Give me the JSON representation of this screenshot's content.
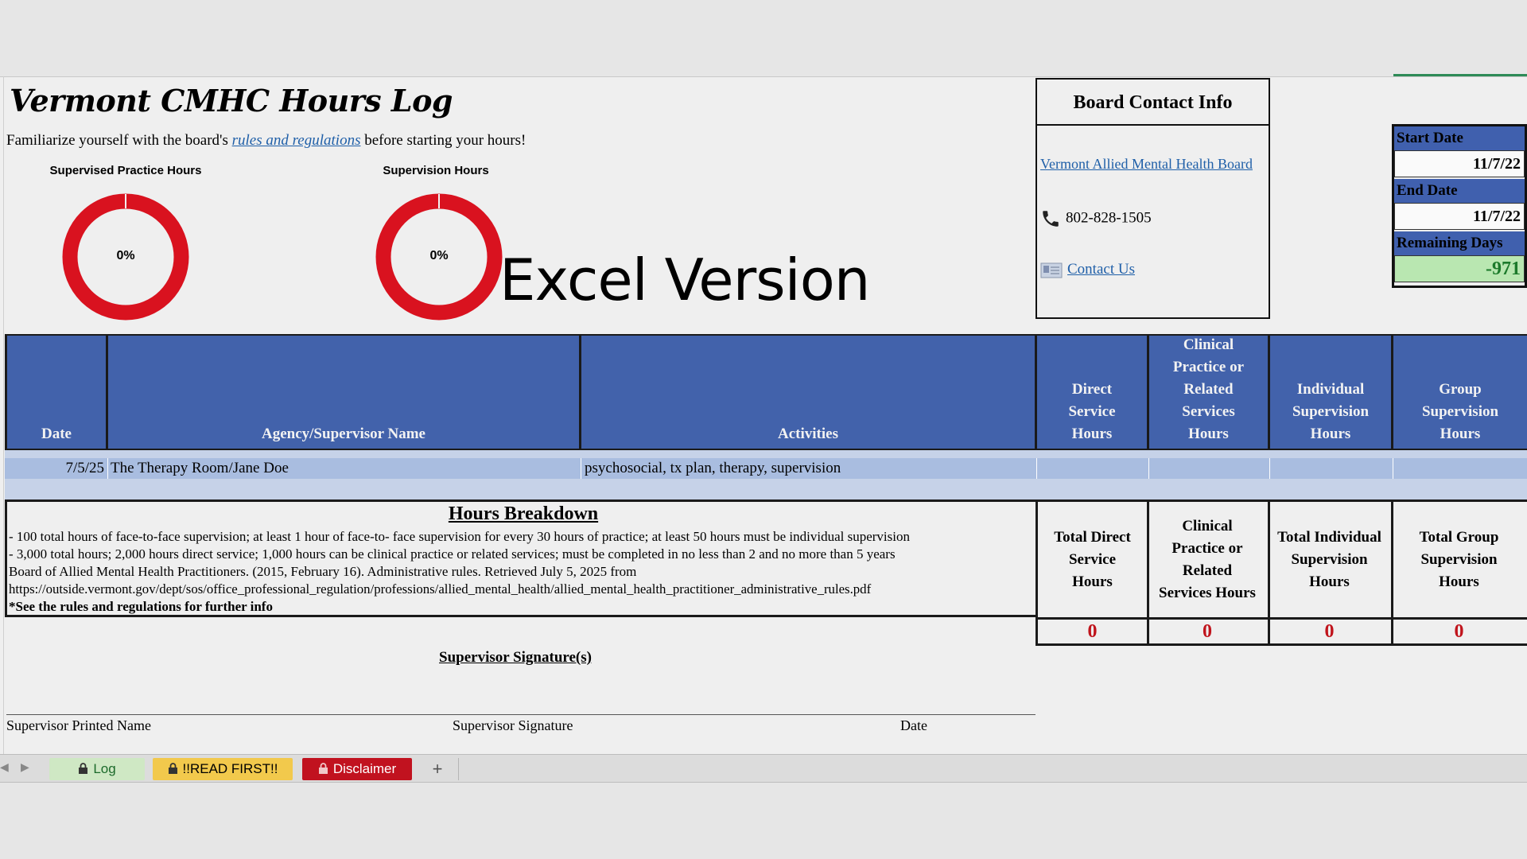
{
  "title": "Vermont CMHC Hours Log",
  "intro": {
    "before": "Familiarize yourself with the board's ",
    "link": "rules and regulations",
    "after": " before starting your hours!"
  },
  "gauges": [
    {
      "title": "Supervised Practice Hours",
      "percent_label": "0%",
      "progress": 0
    },
    {
      "title": "Supervision Hours",
      "percent_label": "0%",
      "progress": 0
    }
  ],
  "overlay_text": "Excel Version",
  "board": {
    "title": "Board Contact Info",
    "link": "Vermont Allied Mental Health Board",
    "phone": "802-828-1505",
    "contact": "Contact Us",
    "icons": {
      "phone": "phone-icon",
      "contact": "mail-icon"
    }
  },
  "dates": {
    "start_label": "Start Date",
    "start_value": "11/7/22",
    "end_label": "End Date",
    "end_value": "11/7/22",
    "remaining_label": "Remaining Days",
    "remaining_value": "-971"
  },
  "table": {
    "headers": {
      "date": "Date",
      "agency": "Agency/Supervisor Name",
      "activities": "Activities",
      "direct": "Direct Service Hours",
      "clinical": "Clinical Practice or Related Services Hours",
      "individual": "Individual Supervision Hours",
      "group": "Group Supervision Hours"
    },
    "rows": [
      {
        "date": "7/5/25",
        "agency": "The Therapy Room/Jane Doe",
        "activities": "psychosocial, tx plan, therapy, supervision",
        "direct": "",
        "clinical": "",
        "individual": "",
        "group": ""
      }
    ]
  },
  "breakdown": {
    "title": "Hours Breakdown",
    "lines": [
      "- 100 total hours of face-to-face supervision; at least 1 hour of face-to- face supervision for every 30 hours of practice; at least 50 hours must be individual supervision",
      "- 3,000 total hours; 2,000 hours direct service; 1,000 hours can be clinical practice or related services; must be completed in no less than 2 and no more than 5 years",
      "Board of Allied Mental Health Practitioners. (2015, February 16). Administrative rules. Retrieved July 5, 2025 from",
      "https://outside.vermont.gov/dept/sos/office_professional_regulation/professions/allied_mental_health/allied_mental_health_practitioner_administrative_rules.pdf",
      "*See the rules and regulations for further info"
    ]
  },
  "totals": {
    "direct_label": "Total Direct Service Hours",
    "clinical_label": "Clinical Practice or Related Services Hours",
    "individual_label": "Total Individual Supervision Hours",
    "group_label": "Total Group Supervision Hours",
    "direct_value": "0",
    "clinical_value": "0",
    "individual_value": "0",
    "group_value": "0"
  },
  "signature": {
    "title": "Supervisor Signature(s)",
    "printed_name": "Supervisor Printed Name",
    "signature": "Supervisor Signature",
    "date": "Date"
  },
  "tabs": [
    {
      "label": "Log",
      "color": "#cfe8c4",
      "text_color": "#1c6a2b"
    },
    {
      "label": "!!READ FIRST!!",
      "color": "#f2c94c",
      "text_color": "#000000"
    },
    {
      "label": "Disclaimer",
      "color": "#c1121f",
      "text_color": "#ffffff"
    }
  ],
  "add_tab_label": "+",
  "colors": {
    "header_blue": "#4262ab",
    "gauge_red": "#d9121f",
    "total_red": "#c0141c",
    "row_blue": "#a9bde0"
  }
}
